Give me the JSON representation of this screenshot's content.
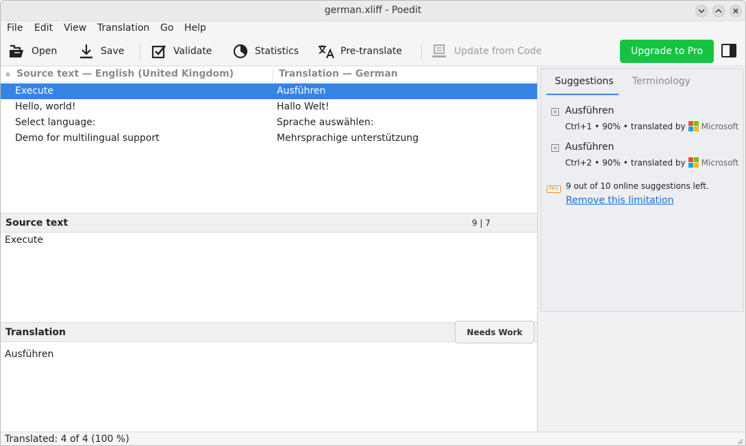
{
  "window": {
    "title": "german.xliff - Poedit",
    "controls": [
      "minimize",
      "maximize",
      "close"
    ]
  },
  "menu": [
    "File",
    "Edit",
    "View",
    "Translation",
    "Go",
    "Help"
  ],
  "toolbar": {
    "open": "Open",
    "save": "Save",
    "validate": "Validate",
    "statistics": "Statistics",
    "pretranslate": "Pre-translate",
    "update_from_code": "Update from Code",
    "upgrade": "Upgrade to Pro"
  },
  "list": {
    "source_header": "Source text — English (United Kingdom)",
    "translation_header": "Translation — German",
    "rows": [
      {
        "source": "Execute",
        "translation": "Ausführen",
        "selected": true
      },
      {
        "source": "Hello, world!",
        "translation": "Hallo Welt!",
        "selected": false
      },
      {
        "source": "Select language:",
        "translation": "Sprache auswählen:",
        "selected": false
      },
      {
        "source": "Demo for multilingual support",
        "translation": "Mehrsprachige unterstützung",
        "selected": false
      }
    ]
  },
  "source_panel": {
    "label": "Source text",
    "count": "9 | 7",
    "text": "Execute"
  },
  "translation_panel": {
    "label": "Translation",
    "needs_work": "Needs Work",
    "text": "Ausführen"
  },
  "sidebar": {
    "tabs": [
      "Suggestions",
      "Terminology"
    ],
    "suggestions": [
      {
        "text": "Ausführen",
        "shortcut": "Ctrl+1",
        "score": "90%",
        "by": "translated by",
        "provider": "Microsoft"
      },
      {
        "text": "Ausführen",
        "shortcut": "Ctrl+2",
        "score": "90%",
        "by": "translated by",
        "provider": "Microsoft"
      }
    ],
    "pro_badge": "PRO",
    "remaining": "9 out of 10 online suggestions left.",
    "remove_link": "Remove this limitation"
  },
  "status": {
    "text": "Translated: 4 of 4 (100 %)"
  },
  "colors": {
    "selection": "#3584e4",
    "upgrade_button": "#15c441",
    "link": "#1c6dd0",
    "ms_red": "#f25022",
    "ms_green": "#7fba00",
    "ms_blue": "#00a4ef",
    "ms_yellow": "#ffb900"
  }
}
